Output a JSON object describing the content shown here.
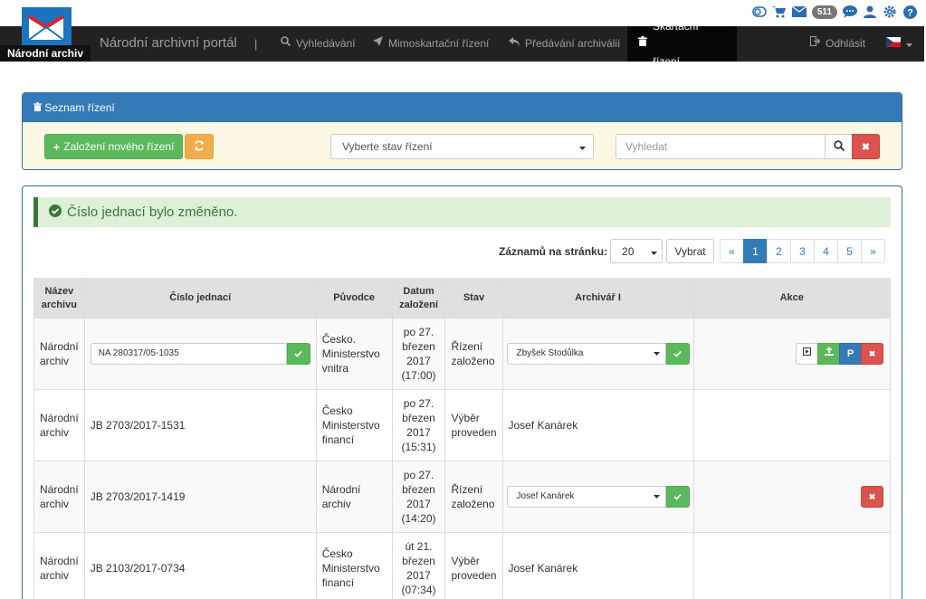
{
  "utility": {
    "icons": [
      "toggle-icon",
      "cart-icon",
      "mail-icon",
      "chat-icon",
      "user-icon",
      "gear-icon",
      "help-icon"
    ],
    "mail_count": "511"
  },
  "brand": {
    "name": "Národní archiv"
  },
  "nav": {
    "title": "Národní archivní portál",
    "separator": "|",
    "items": [
      {
        "label": "Vyhledávání",
        "icon": "search-icon"
      },
      {
        "label": "Mimoskartační řízení",
        "icon": "send-icon"
      },
      {
        "label": "Předávání archiválií",
        "icon": "reply-icon"
      },
      {
        "label": "Skartační řízení",
        "icon": "trash-icon",
        "active": true
      }
    ],
    "logout": "Odhlásit",
    "language": "CZ"
  },
  "panel": {
    "title": "Seznam řízení",
    "new_button": "Založení nového řízení",
    "state_select": "Vyberte stav řízení",
    "search_placeholder": "Vyhledat"
  },
  "alert": {
    "text": "Číslo jednací bylo změněno."
  },
  "paging": {
    "per_page_label": "Záznamů na stránku:",
    "per_page_value": "20",
    "choose_button": "Vybrat",
    "pages": [
      "«",
      "1",
      "2",
      "3",
      "4",
      "5",
      "»"
    ],
    "active_page": "1"
  },
  "table": {
    "headers": [
      "Název archivu",
      "Číslo jednací",
      "Původce",
      "Datum založení",
      "Stav",
      "Archivář I",
      "Akce"
    ],
    "rows": [
      {
        "archive": "Národní archiv",
        "number": "NA 280317/05-1035",
        "number_editable": true,
        "originator": "Česko. Ministerstvo vnitra",
        "date": "po 27. březen 2017 (17:00)",
        "state": "Řízení založeno",
        "archivist": "Zbyšek Stodůlka",
        "archivist_editable": true,
        "actions": [
          "play-icon",
          "upload-icon",
          "p-icon",
          "close-icon"
        ]
      },
      {
        "archive": "Národní archiv",
        "number": "JB 2703/2017-1531",
        "number_editable": false,
        "originator": "Česko Ministerstvo financí",
        "date": "po 27. březen 2017 (15:31)",
        "state": "Výběr proveden",
        "archivist": "Josef Kanárek",
        "archivist_editable": false,
        "actions": []
      },
      {
        "archive": "Národní archiv",
        "number": "JB 2703/2017-1419",
        "number_editable": false,
        "originator": "Národní archiv",
        "date": "po 27. březen 2017 (14:20)",
        "state": "Řízení založeno",
        "archivist": "Josef Kanárek",
        "archivist_editable": true,
        "actions": [
          "close-icon"
        ]
      },
      {
        "archive": "Národní archiv",
        "number": "JB 2103/2017-0734",
        "number_editable": false,
        "originator": "Česko Ministerstvo financí",
        "date": "út 21. březen 2017 (07:34)",
        "state": "Výběr proveden",
        "archivist": "Josef Kanárek",
        "archivist_editable": false,
        "actions": []
      }
    ]
  }
}
